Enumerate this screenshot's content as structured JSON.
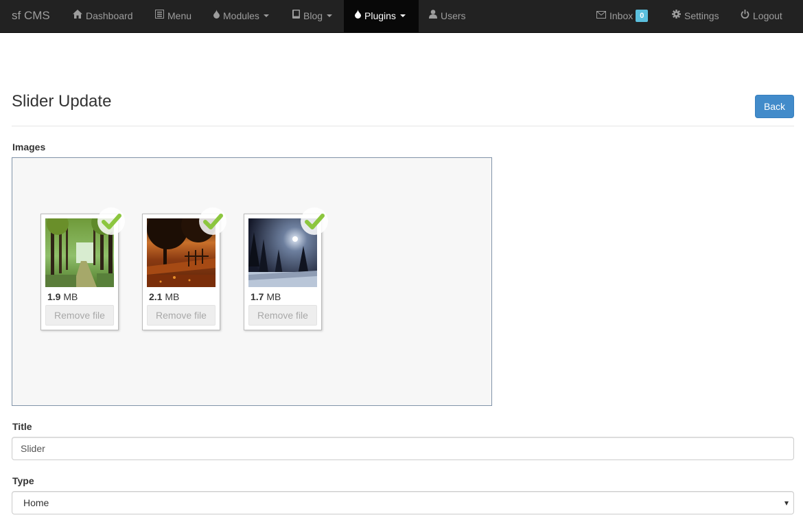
{
  "nav": {
    "brand": "sf CMS",
    "items": [
      {
        "label": "Dashboard",
        "icon": "home-icon"
      },
      {
        "label": "Menu",
        "icon": "list-icon"
      },
      {
        "label": "Modules",
        "icon": "drop-icon",
        "dropdown": true
      },
      {
        "label": "Blog",
        "icon": "book-icon",
        "dropdown": true
      },
      {
        "label": "Plugins",
        "icon": "drop-icon",
        "dropdown": true,
        "active": true
      },
      {
        "label": "Users",
        "icon": "user-icon"
      }
    ],
    "right": [
      {
        "label": "Inbox",
        "icon": "envelope-icon",
        "badge": "0"
      },
      {
        "label": "Settings",
        "icon": "gear-icon"
      },
      {
        "label": "Logout",
        "icon": "power-icon"
      }
    ]
  },
  "page": {
    "title": "Slider Update",
    "back_label": "Back"
  },
  "images": {
    "label": "Images",
    "files": [
      {
        "size_value": "1.9",
        "size_unit": "MB",
        "remove_label": "Remove file",
        "scene": "forest-path"
      },
      {
        "size_value": "2.1",
        "size_unit": "MB",
        "remove_label": "Remove file",
        "scene": "autumn-sunset"
      },
      {
        "size_value": "1.7",
        "size_unit": "MB",
        "remove_label": "Remove file",
        "scene": "snowy-night"
      }
    ]
  },
  "form": {
    "title_label": "Title",
    "title_value": "Slider",
    "type_label": "Type",
    "type_value": "Home"
  },
  "colors": {
    "primary": "#428bca",
    "navbar": "#222222",
    "navbar_active": "#080808",
    "badge": "#5bc0de",
    "check": "#8cc63f"
  }
}
